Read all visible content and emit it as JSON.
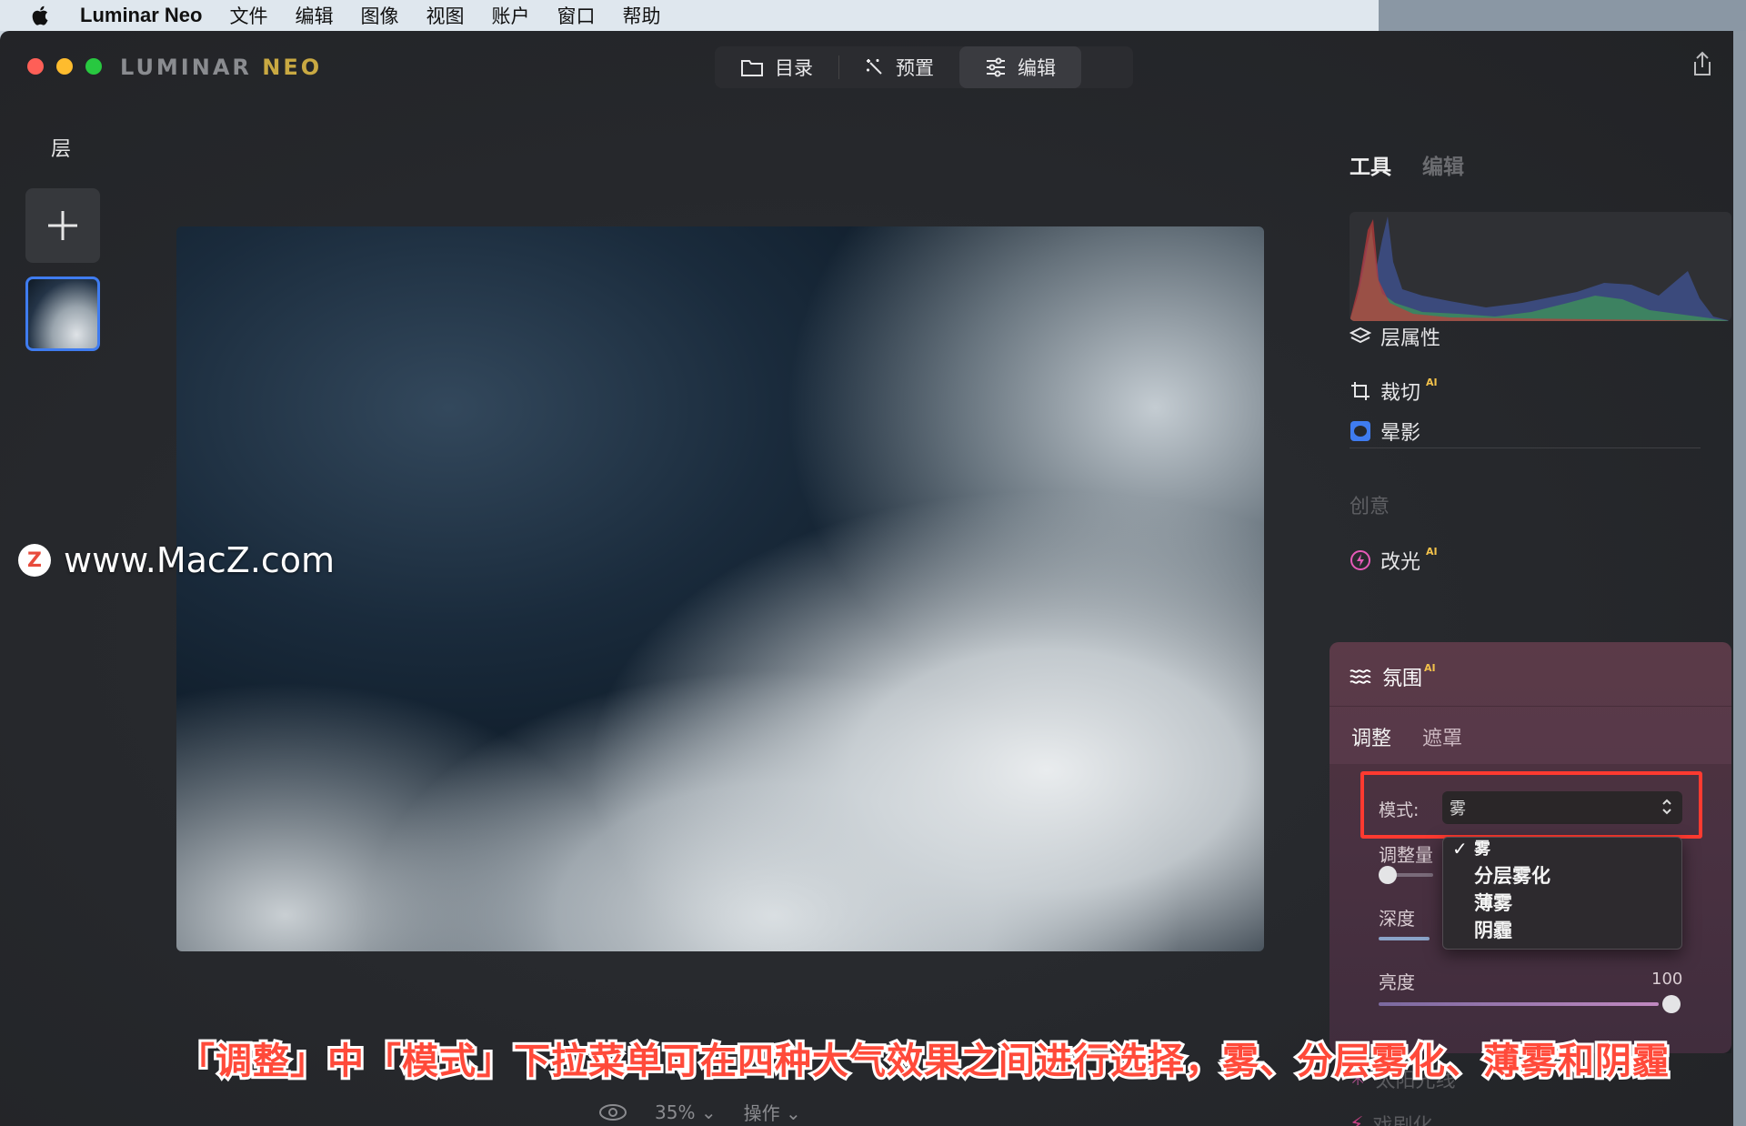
{
  "menubar": {
    "app_name": "Luminar Neo",
    "items": [
      "文件",
      "编辑",
      "图像",
      "视图",
      "账户",
      "窗口",
      "帮助"
    ]
  },
  "app": {
    "logo_left": "LUMINAR",
    "logo_right": "NEO",
    "tabs": [
      {
        "label": "目录",
        "icon": "folder-icon"
      },
      {
        "label": "预置",
        "icon": "magic-wand-icon"
      },
      {
        "label": "编辑",
        "icon": "sliders-icon",
        "active": true
      }
    ]
  },
  "layers": {
    "title": "层"
  },
  "watermark": {
    "text": "www.MacZ.com",
    "logo_letter": "Z"
  },
  "bottom": {
    "zoom": "35%",
    "actions": "操作"
  },
  "right_panel": {
    "tabs": [
      "工具",
      "编辑"
    ],
    "tools": [
      {
        "label": "层属性",
        "icon": "layers-icon"
      },
      {
        "label": "裁切",
        "icon": "crop-icon",
        "ai": "AI"
      },
      {
        "label": "晕影",
        "icon": "vignette-icon"
      }
    ],
    "section_creative": "创意",
    "relight": {
      "label": "改光",
      "ai": "AI"
    },
    "atmosphere": {
      "title": "氛围",
      "ai": "AI",
      "tabs": [
        "调整",
        "遮罩"
      ],
      "mode_label": "模式:",
      "mode_value": "雾",
      "sliders": [
        {
          "label": "调整量"
        },
        {
          "label": "深度"
        },
        {
          "label": "亮度",
          "value": "100"
        }
      ],
      "dropdown_options": [
        "雾",
        "分层雾化",
        "薄雾",
        "阴霾"
      ],
      "dropdown_selected": "雾"
    },
    "faded_items": [
      "太阳光线",
      "戏剧化"
    ]
  },
  "caption": "「调整」中「模式」下拉菜单可在四种大气效果之间进行选择，雾、分层雾化、薄雾和阴霾",
  "colors": {
    "accent_blue": "#3f7cf0",
    "highlight_red": "#ff3a30",
    "atmosphere_panel": "#5b3a48"
  }
}
